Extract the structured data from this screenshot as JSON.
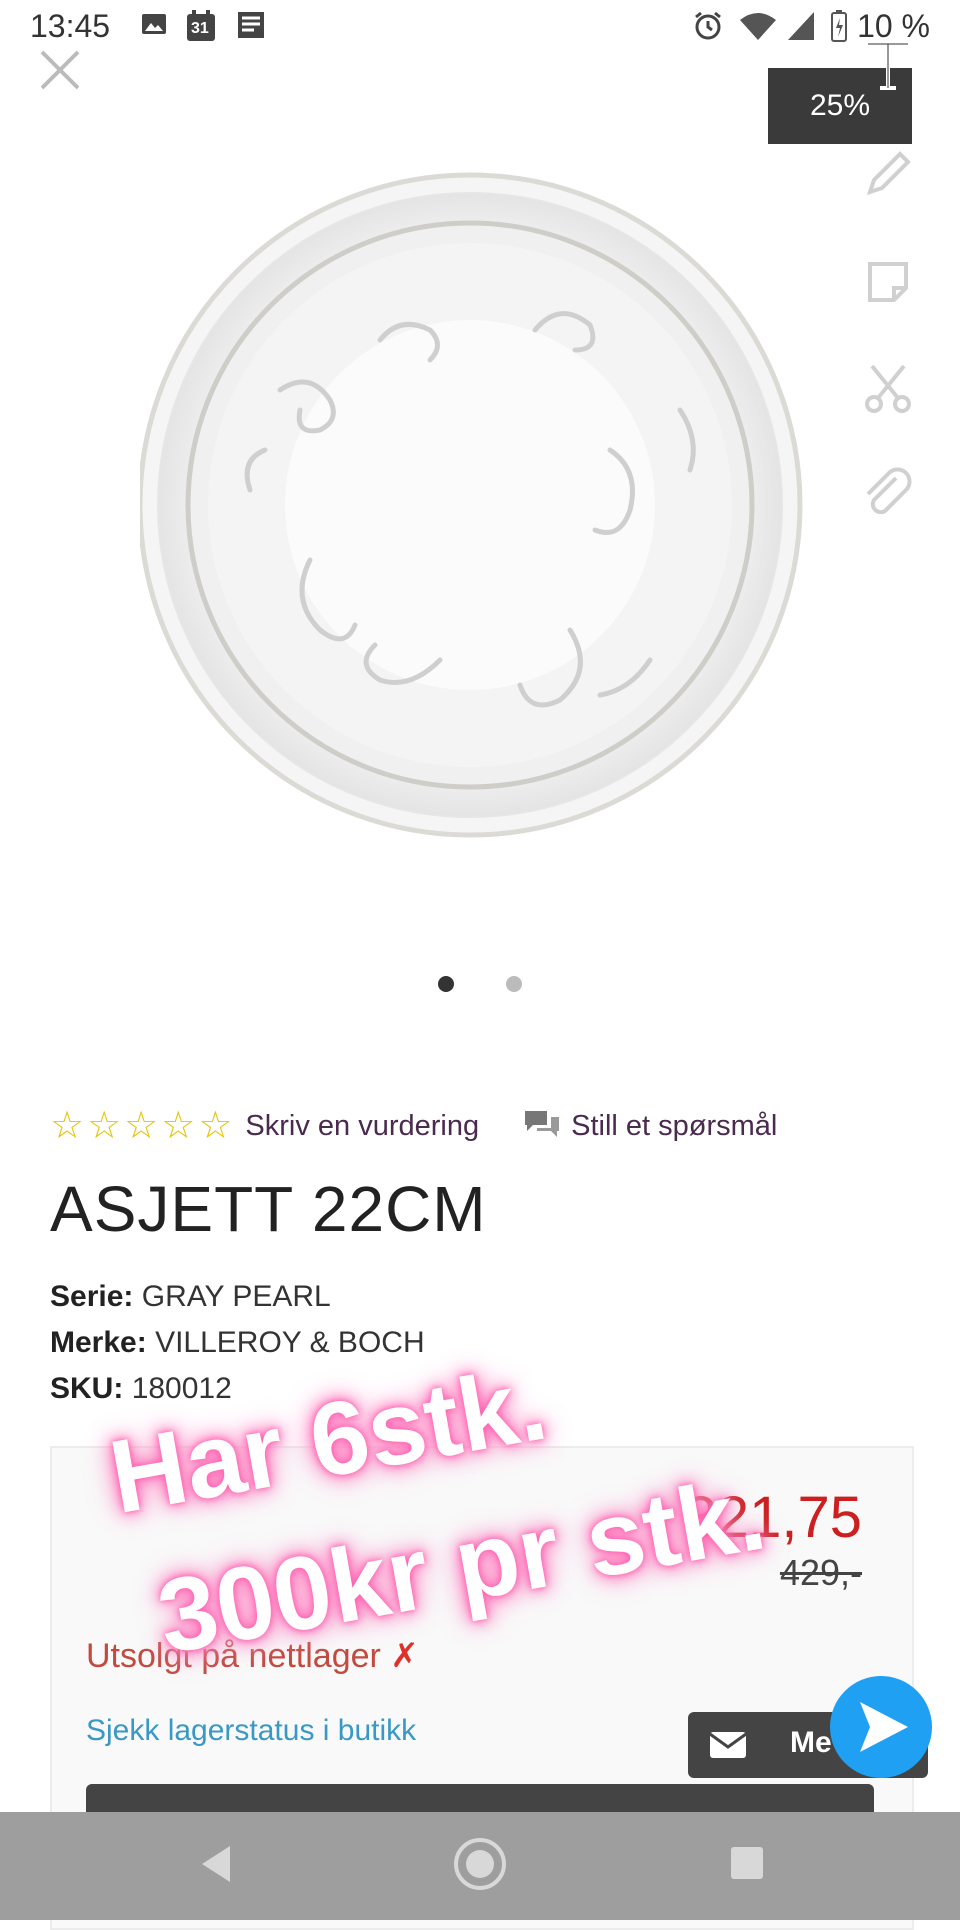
{
  "status_bar": {
    "time": "13:45",
    "calendar_day": "31",
    "battery": "10 %"
  },
  "editor": {
    "zoom": "25%",
    "tools": [
      "text-tool",
      "pencil-tool",
      "sticker-tool",
      "scissors-tool",
      "paperclip-tool"
    ]
  },
  "carousel": {
    "count": 2,
    "active": 0
  },
  "product": {
    "rating_link": "Skriv en vurdering",
    "question_link": "Still et spørsmål",
    "title": "ASJETT 22CM",
    "series_label": "Serie:",
    "series_value": "GRAY PEARL",
    "brand_label": "Merke:",
    "brand_value": "VILLEROY & BOCH",
    "sku_label": "SKU:",
    "sku_value": "180012",
    "rating_stars": 0,
    "rating_max": 5
  },
  "price": {
    "current": "321,75",
    "old": "429,-",
    "soldout": "Utsolgt på nettlager",
    "soldout_mark": "✗",
    "stock_link": "Sjekk lagerstatus i butikk"
  },
  "chat": {
    "label": "Me"
  },
  "overlay_text": {
    "line1": "Har 6stk.",
    "line2": "300kr pr stk."
  },
  "colors": {
    "price_red": "#cc1f1f",
    "link_blue": "#3a98c4",
    "soldout_red": "#c24a3e",
    "star_yellow": "#e6c300",
    "overlay_glow": "#ff5fb0",
    "fab_blue": "#1fa0f2"
  }
}
